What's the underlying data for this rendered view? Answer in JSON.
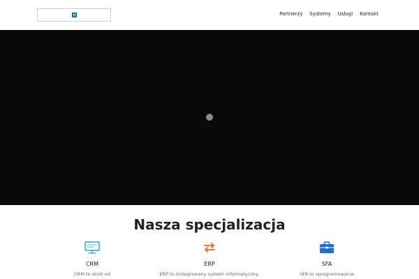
{
  "header": {
    "logo_alt": "logo",
    "nav": [
      {
        "label": "Partnerzy"
      },
      {
        "label": "Systemy"
      },
      {
        "label": "Usługi"
      },
      {
        "label": "Kontakt"
      }
    ]
  },
  "hero": {
    "icon": "loading-spinner"
  },
  "section": {
    "title": "Nasza specjalizacja"
  },
  "features": [
    {
      "title": "CRM",
      "desc": "CRM to skrót od",
      "icon": "monitor-icon",
      "color": "#2a9fd6"
    },
    {
      "title": "ERP",
      "desc": "ERP to zintegrowany system informatyczny,",
      "icon": "swap-arrows-icon",
      "color": "#e8672a"
    },
    {
      "title": "SFA",
      "desc": "SFA to oprogramowanie",
      "icon": "briefcase-icon",
      "color": "#1f6fc4"
    }
  ]
}
